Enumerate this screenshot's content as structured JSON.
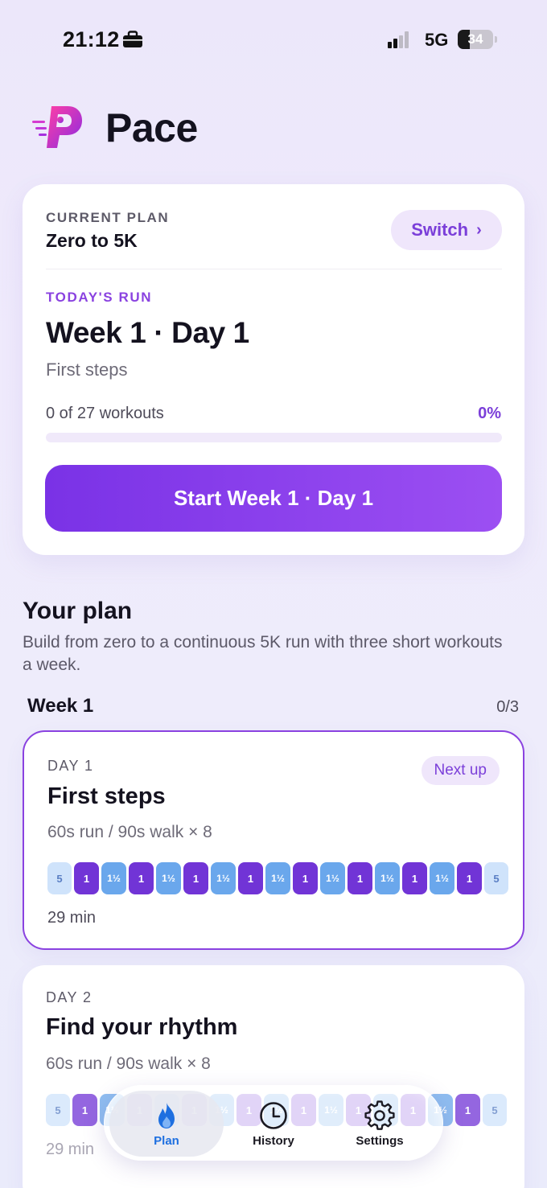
{
  "status_bar": {
    "time": "21:12",
    "network": "5G",
    "battery": "34"
  },
  "app": {
    "title": "Pace",
    "brand_color": "#8a42e0"
  },
  "current_plan": {
    "label": "CURRENT PLAN",
    "name": "Zero to 5K",
    "switch_label": "Switch",
    "todays_run_label": "TODAY'S RUN",
    "todays_run_title": "Week 1 · Day 1",
    "todays_run_subtitle": "First steps",
    "progress_text": "0 of 27 workouts",
    "progress_percent_label": "0%",
    "progress_fraction": 0,
    "start_button": "Start Week 1 · Day 1"
  },
  "your_plan": {
    "title": "Your plan",
    "description": "Build from zero to a continuous 5K run with three short workouts a week.",
    "week_label": "Week 1",
    "week_count": "0/3"
  },
  "days": [
    {
      "day": "DAY 1",
      "title": "First steps",
      "description": "60s run / 90s walk × 8",
      "badge": "Next up",
      "duration": "29 min",
      "segments": [
        {
          "type": "warm",
          "label": "5"
        },
        {
          "type": "run",
          "label": "1"
        },
        {
          "type": "walk",
          "label": "1½"
        },
        {
          "type": "run",
          "label": "1"
        },
        {
          "type": "walk",
          "label": "1½"
        },
        {
          "type": "run",
          "label": "1"
        },
        {
          "type": "walk",
          "label": "1½"
        },
        {
          "type": "run",
          "label": "1"
        },
        {
          "type": "walk",
          "label": "1½"
        },
        {
          "type": "run",
          "label": "1"
        },
        {
          "type": "walk",
          "label": "1½"
        },
        {
          "type": "run",
          "label": "1"
        },
        {
          "type": "walk",
          "label": "1½"
        },
        {
          "type": "run",
          "label": "1"
        },
        {
          "type": "walk",
          "label": "1½"
        },
        {
          "type": "run",
          "label": "1"
        },
        {
          "type": "warm",
          "label": "5"
        }
      ]
    },
    {
      "day": "DAY 2",
      "title": "Find your rhythm",
      "description": "60s run / 90s walk × 8",
      "duration": "29 min",
      "segments": [
        {
          "type": "warm",
          "label": "5"
        },
        {
          "type": "run",
          "label": "1"
        },
        {
          "type": "walk",
          "label": "1½"
        },
        {
          "type": "run",
          "label": "1"
        },
        {
          "type": "walk",
          "label": "1½"
        },
        {
          "type": "run",
          "label": "1"
        },
        {
          "type": "walk",
          "label": "1½"
        },
        {
          "type": "run",
          "label": "1"
        },
        {
          "type": "walk",
          "label": "1½"
        },
        {
          "type": "run",
          "label": "1"
        },
        {
          "type": "walk",
          "label": "1½"
        },
        {
          "type": "run",
          "label": "1"
        },
        {
          "type": "walk",
          "label": "1½"
        },
        {
          "type": "run",
          "label": "1"
        },
        {
          "type": "walk",
          "label": "1½"
        },
        {
          "type": "run",
          "label": "1"
        },
        {
          "type": "warm",
          "label": "5"
        }
      ]
    }
  ],
  "tab_bar": {
    "tabs": [
      {
        "label": "Plan",
        "icon": "flame-icon",
        "active": true
      },
      {
        "label": "History",
        "icon": "clock-icon",
        "active": false
      },
      {
        "label": "Settings",
        "icon": "gear-icon",
        "active": false
      }
    ]
  }
}
